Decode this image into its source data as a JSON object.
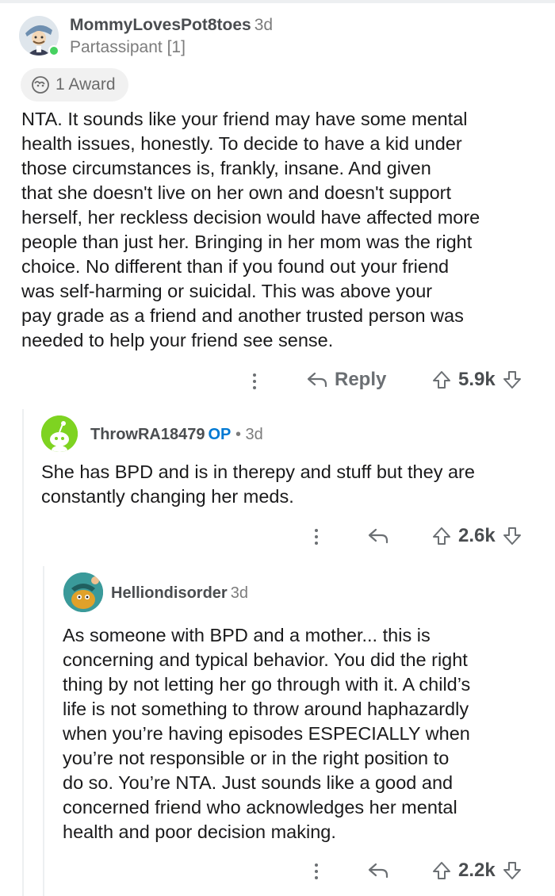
{
  "comments": [
    {
      "username": "MommyLovesPot8toes",
      "age": "3d",
      "flair": "Partassipant [1]",
      "award_label": "1 Award",
      "body_lines": [
        "NTA. It sounds like your friend may have some mental",
        "health issues, honestly. To decide to have a kid under",
        "those circumstances is, frankly, insane. And given",
        "that she doesn't live on her own and doesn't support",
        "herself, her reckless decision would have affected more",
        "people than just her. Bringing in her mom was the right",
        "choice. No different than if you found out your friend",
        "was self-harming or suicidal. This was above your",
        "pay grade as a friend and another trusted person was",
        "needed to help your friend see sense."
      ],
      "reply_label": "Reply",
      "score": "5.9k"
    },
    {
      "username": "ThrowRA18479",
      "op_badge": "OP",
      "separator": " • ",
      "age": "3d",
      "body_lines": [
        "She has BPD and is in therepy and stuff but they are",
        "constantly changing her meds."
      ],
      "score": "2.6k"
    },
    {
      "username": "Helliondisorder",
      "age": "3d",
      "body_lines": [
        "As someone with BPD and a mother... this is",
        "concerning and typical behavior. You did the right",
        "thing by not letting her go through with it. A child’s",
        "life is not something to throw around haphazardly",
        "when you’re having episodes ESPECIALLY when",
        "you’re not responsible or in the right position to",
        "do so. You’re NTA. Just sounds like a good and",
        "concerned friend who acknowledges her mental",
        "health and poor decision making."
      ],
      "score": "2.2k"
    }
  ],
  "colors": {
    "op_blue": "#0079d3",
    "online_green": "#46d160",
    "meta_gray": "#7c7c7c",
    "text": "#1a1a1b"
  },
  "icons": [
    "award-icon",
    "more-options-icon",
    "reply-arrow-icon",
    "upvote-icon",
    "downvote-icon"
  ]
}
